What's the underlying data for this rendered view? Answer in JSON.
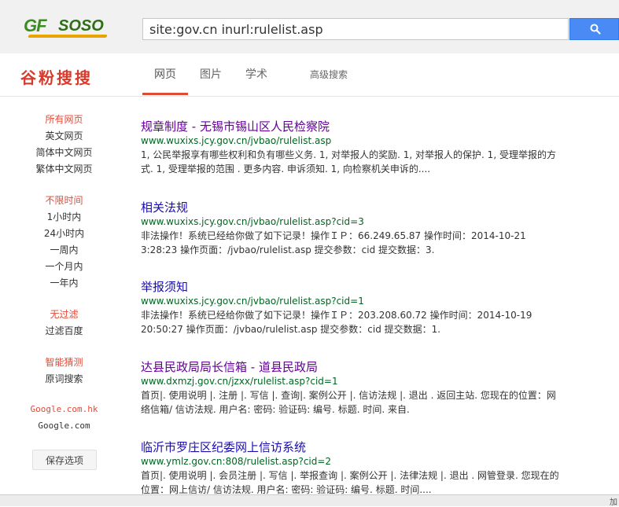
{
  "header": {
    "logo_text_g": "GF",
    "logo_text_rest": "SOSO",
    "search_query": "site:gov.cn inurl:rulelist.asp",
    "search_button_icon": "search-icon",
    "accent_color": "#4a8af4"
  },
  "nav": {
    "brand": "谷粉搜搜",
    "tabs": [
      "网页",
      "图片",
      "学术"
    ],
    "advanced": "高级搜索"
  },
  "sidebar": {
    "language": [
      "所有网页",
      "英文网页",
      "简体中文网页",
      "繁体中文网页"
    ],
    "time": [
      "不限时间",
      "1小时内",
      "24小时内",
      "一周内",
      "一个月内",
      "一年内"
    ],
    "filter": [
      "无过滤",
      "过滤百度"
    ],
    "guess": [
      "智能猜测",
      "原词搜索"
    ],
    "engines": [
      "Google.com.hk",
      "Google.com"
    ],
    "save_label": "保存选项"
  },
  "results": [
    {
      "title": "规章制度 - 无锡市锡山区人民检察院",
      "url": "www.wuxixs.jcy.gov.cn/jvbao/rulelist.asp",
      "snippet": "1, 公民举报享有哪些权利和负有哪些义务. 1, 对举报人的奖励. 1, 对举报人的保护. 1, 受理举报的方式. 1, 受理举报的范围 . 更多内容. 申诉须知. 1, 向检察机关申诉的....",
      "visited": true
    },
    {
      "title": "相关法规",
      "url": "www.wuxixs.jcy.gov.cn/jvbao/rulelist.asp?cid=3",
      "snippet": "非法操作！系统已经给你做了如下记录！操作ＩＰ：66.249.65.87 操作时间：2014-10-21 3:28:23 操作页面：/jvbao/rulelist.asp 提交参数：cid 提交数据：3.",
      "visited": false
    },
    {
      "title": "举报须知",
      "url": "www.wuxixs.jcy.gov.cn/jvbao/rulelist.asp?cid=1",
      "snippet": "非法操作！系统已经给你做了如下记录！操作ＩＰ：203.208.60.72 操作时间：2014-10-19 20:50:27 操作页面：/jvbao/rulelist.asp 提交参数：cid 提交数据：1.",
      "visited": false
    },
    {
      "title": "达县民政局局长信箱 - 道县民政局",
      "url": "www.dxmzj.gov.cn/jzxx/rulelist.asp?cid=1",
      "snippet": "首页|. 使用说明 |. 注册 |. 写信 |. 查询|. 案例公开 |. 信访法规 |. 退出 . 返回主站. 您现在的位置：网络信箱/ 信访法规. 用户名: 密码: 验证码: 编号. 标题. 时间. 来自.",
      "visited": true
    },
    {
      "title": "临沂市罗庄区纪委网上信访系统",
      "url": "www.ymlz.gov.cn:808/rulelist.asp?cid=2",
      "snippet": "首页|. 使用说明 |. 会员注册 |. 写信 |. 举报查询 |. 案例公开 |. 法律法规 |. 退出 . 网管登录. 您现在的位置：网上信访/ 信访法规. 用户名: 密码: 验证码: 编号. 标题. 时间....",
      "visited": false
    }
  ],
  "statusbar": {
    "text": "加"
  }
}
